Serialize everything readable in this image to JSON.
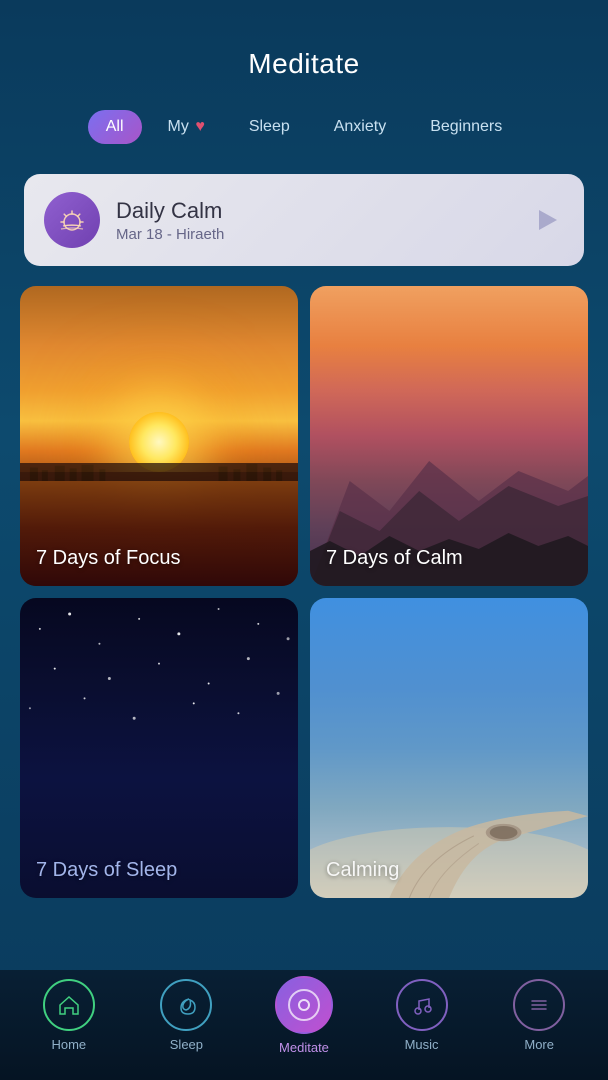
{
  "header": {
    "title": "Meditate"
  },
  "filters": [
    {
      "label": "All",
      "active": true,
      "id": "all"
    },
    {
      "label": "My ♥",
      "active": false,
      "id": "my"
    },
    {
      "label": "Sleep",
      "active": false,
      "id": "sleep"
    },
    {
      "label": "Anxiety",
      "active": false,
      "id": "anxiety"
    },
    {
      "label": "Beginners",
      "active": false,
      "id": "beginners"
    }
  ],
  "daily_calm": {
    "title": "Daily Calm",
    "subtitle": "Mar 18 - Hiraeth"
  },
  "cards": [
    {
      "id": "focus",
      "label": "7 Days of Focus"
    },
    {
      "id": "calm",
      "label": "7 Days of Calm"
    },
    {
      "id": "sleep_card",
      "label": "Sleep"
    },
    {
      "id": "calming",
      "label": "Calming"
    }
  ],
  "nav": {
    "items": [
      {
        "label": "Home",
        "id": "home",
        "active": false
      },
      {
        "label": "Sleep",
        "id": "sleep_nav",
        "active": false
      },
      {
        "label": "Meditate",
        "id": "meditate",
        "active": true
      },
      {
        "label": "Music",
        "id": "music",
        "active": false
      },
      {
        "label": "More",
        "id": "more",
        "active": false
      }
    ]
  }
}
